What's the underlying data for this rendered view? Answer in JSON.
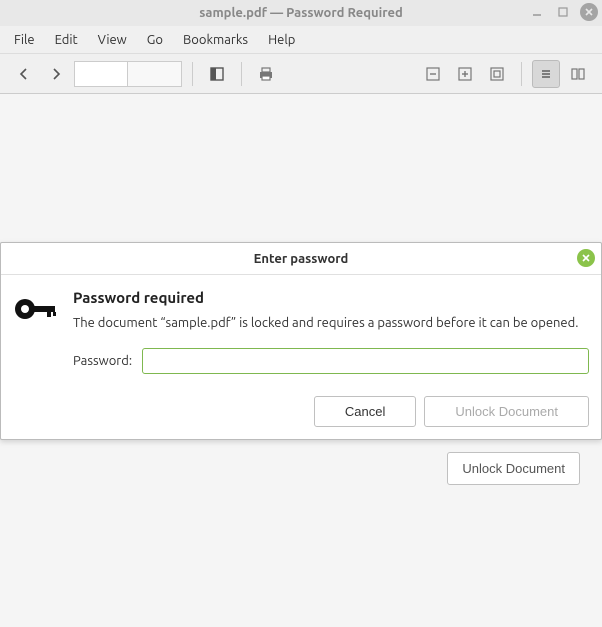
{
  "window": {
    "title": "sample.pdf — Password Required"
  },
  "menubar": {
    "file": "File",
    "edit": "Edit",
    "view": "View",
    "go": "Go",
    "bookmarks": "Bookmarks",
    "help": "Help"
  },
  "toolbar": {
    "page_value": "",
    "page_count": ""
  },
  "content": {
    "bg_unlock": "Unlock Document"
  },
  "dialog": {
    "title": "Enter password",
    "heading": "Password required",
    "message": "The document “sample.pdf” is locked and requires a password before it can be opened.",
    "password_label": "Password:",
    "password_value": "",
    "cancel": "Cancel",
    "unlock": "Unlock Document"
  }
}
